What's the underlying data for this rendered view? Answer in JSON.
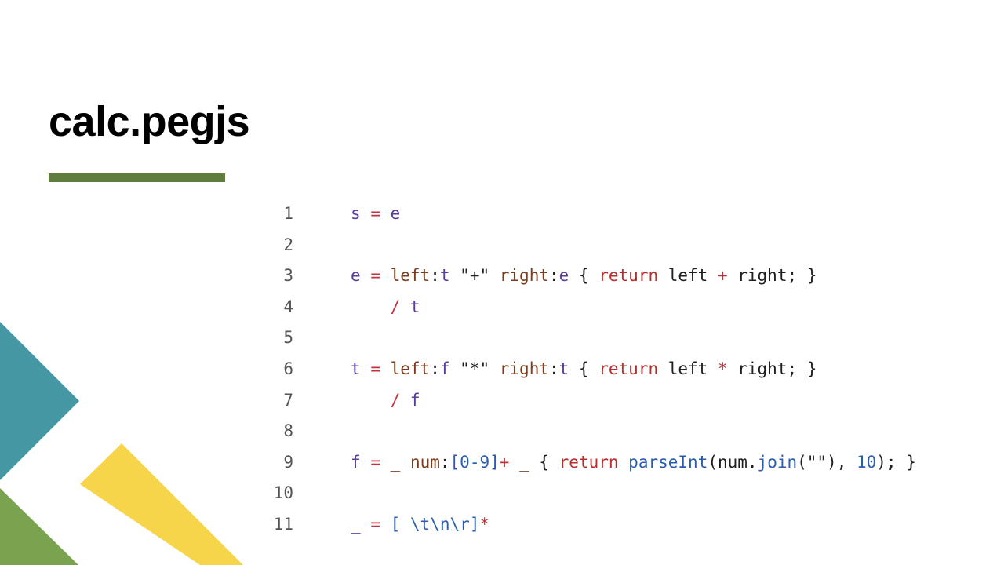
{
  "slide": {
    "title": "calc.pegjs"
  },
  "colors": {
    "underline": "#5e7d3f",
    "teal": "#4497a3",
    "green": "#7aa350",
    "yellow": "#f7d54a"
  },
  "code": {
    "lines": [
      {
        "n": "1",
        "tokens": [
          [
            "sym",
            "s"
          ],
          [
            "pl",
            " "
          ],
          [
            "op",
            "="
          ],
          [
            "pl",
            " "
          ],
          [
            "sym",
            "e"
          ]
        ]
      },
      {
        "n": "2",
        "tokens": []
      },
      {
        "n": "3",
        "tokens": [
          [
            "sym",
            "e"
          ],
          [
            "pl",
            " "
          ],
          [
            "op",
            "="
          ],
          [
            "pl",
            " "
          ],
          [
            "lbl",
            "left"
          ],
          [
            "pl",
            ":"
          ],
          [
            "sym",
            "t"
          ],
          [
            "pl",
            " "
          ],
          [
            "str",
            "\"+\""
          ],
          [
            "pl",
            " "
          ],
          [
            "lbl",
            "right"
          ],
          [
            "pl",
            ":"
          ],
          [
            "sym",
            "e"
          ],
          [
            "pl",
            " { "
          ],
          [
            "kw",
            "return"
          ],
          [
            "pl",
            " left "
          ],
          [
            "op",
            "+"
          ],
          [
            "pl",
            " right; }"
          ]
        ]
      },
      {
        "n": "4",
        "tokens": [
          [
            "pl",
            "    "
          ],
          [
            "op",
            "/"
          ],
          [
            "pl",
            " "
          ],
          [
            "sym",
            "t"
          ]
        ]
      },
      {
        "n": "5",
        "tokens": []
      },
      {
        "n": "6",
        "tokens": [
          [
            "sym",
            "t"
          ],
          [
            "pl",
            " "
          ],
          [
            "op",
            "="
          ],
          [
            "pl",
            " "
          ],
          [
            "lbl",
            "left"
          ],
          [
            "pl",
            ":"
          ],
          [
            "sym",
            "f"
          ],
          [
            "pl",
            " "
          ],
          [
            "str",
            "\"*\""
          ],
          [
            "pl",
            " "
          ],
          [
            "lbl",
            "right"
          ],
          [
            "pl",
            ":"
          ],
          [
            "sym",
            "t"
          ],
          [
            "pl",
            " { "
          ],
          [
            "kw",
            "return"
          ],
          [
            "pl",
            " left "
          ],
          [
            "op",
            "*"
          ],
          [
            "pl",
            " right; }"
          ]
        ]
      },
      {
        "n": "7",
        "tokens": [
          [
            "pl",
            "    "
          ],
          [
            "op",
            "/"
          ],
          [
            "pl",
            " "
          ],
          [
            "sym",
            "f"
          ]
        ]
      },
      {
        "n": "8",
        "tokens": []
      },
      {
        "n": "9",
        "tokens": [
          [
            "sym",
            "f"
          ],
          [
            "pl",
            " "
          ],
          [
            "op",
            "="
          ],
          [
            "pl",
            " "
          ],
          [
            "lbl",
            "_"
          ],
          [
            "pl",
            " "
          ],
          [
            "lbl",
            "num"
          ],
          [
            "pl",
            ":"
          ],
          [
            "num",
            "[0-9]"
          ],
          [
            "op",
            "+"
          ],
          [
            "pl",
            " "
          ],
          [
            "lbl",
            "_"
          ],
          [
            "pl",
            " { "
          ],
          [
            "kw",
            "return"
          ],
          [
            "pl",
            " "
          ],
          [
            "fn",
            "parseInt"
          ],
          [
            "pl",
            "(num."
          ],
          [
            "fn",
            "join"
          ],
          [
            "pl",
            "(\"\"), "
          ],
          [
            "num",
            "10"
          ],
          [
            "pl",
            "); }"
          ]
        ]
      },
      {
        "n": "10",
        "tokens": []
      },
      {
        "n": "11",
        "tokens": [
          [
            "sym",
            "_"
          ],
          [
            "pl",
            " "
          ],
          [
            "op",
            "="
          ],
          [
            "pl",
            " "
          ],
          [
            "num",
            "[ \\t\\n\\r]"
          ],
          [
            "op",
            "*"
          ]
        ]
      }
    ]
  }
}
